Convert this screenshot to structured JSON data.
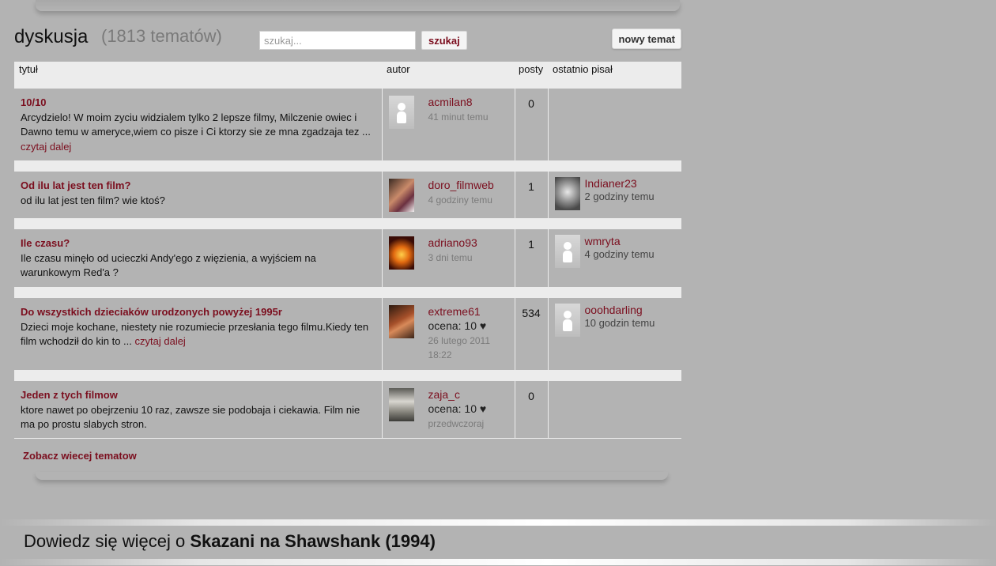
{
  "header": {
    "title": "dyskusja",
    "count": "(1813 tematów)",
    "search_placeholder": "szukaj...",
    "search_label": "szukaj",
    "new_topic_label": "nowy temat"
  },
  "table": {
    "headers": [
      "tytuł",
      "autor",
      "posty",
      "ostatnio pisał"
    ],
    "rows": [
      {
        "title": "10/10",
        "excerpt": "Arcydzielo! W moim zyciu widzialem tylko 2 lepsze filmy, Milczenie owiec i Dawno temu w ameryce,wiem co pisze i Ci ktorzy sie ze mna zgadzaja tez ...",
        "read_more": "czytaj dalej",
        "author": "acmilan8",
        "rating": "",
        "time": "41 minut temu",
        "posts": "0",
        "last_author": "",
        "last_time": ""
      },
      {
        "title": "Od ilu lat jest ten film?",
        "excerpt": "od ilu lat jest ten film? wie ktoś?",
        "read_more": "",
        "author": "doro_filmweb",
        "rating": "",
        "time": "4 godziny temu",
        "posts": "1",
        "last_author": "Indianer23",
        "last_time": "2 godziny temu"
      },
      {
        "title": "Ile czasu?",
        "excerpt": "Ile czasu minęło od ucieczki Andy'ego z więzienia, a wyjściem na warunkowym Red'a ?",
        "read_more": "",
        "author": "adriano93",
        "rating": "",
        "time": "3 dni temu",
        "posts": "1",
        "last_author": "wmryta",
        "last_time": "4 godziny temu"
      },
      {
        "title": "Do wszystkich dzieciaków urodzonych powyżej 1995r",
        "excerpt": "Dzieci moje kochane, niestety nie rozumiecie przesłania tego filmu.Kiedy ten film wchodził do kin to ...",
        "read_more": "czytaj dalej",
        "author": "extreme61",
        "rating": "ocena: 10 ♥",
        "time": "26 lutego 2011 18:22",
        "posts": "534",
        "last_author": "ooohdarling",
        "last_time": "10 godzin temu"
      },
      {
        "title": "Jeden z tych filmow",
        "excerpt": "ktore nawet po obejrzeniu 10 raz, zawsze sie podobaja i ciekawia. Film nie ma po prostu slabych stron.",
        "read_more": "",
        "author": "zaja_c",
        "rating": "ocena: 10 ♥",
        "time": "przedwczoraj",
        "posts": "0",
        "last_author": "",
        "last_time": ""
      }
    ]
  },
  "more_topics": "Zobacz wiecej tematow",
  "footer": {
    "prefix": "Dowiedz się więcej o",
    "movie": "Skazani na Shawshank (1994)"
  },
  "colors": {
    "accent": "#7b0e1e",
    "background": "#b3b3b3",
    "header_row": "#ececec"
  }
}
